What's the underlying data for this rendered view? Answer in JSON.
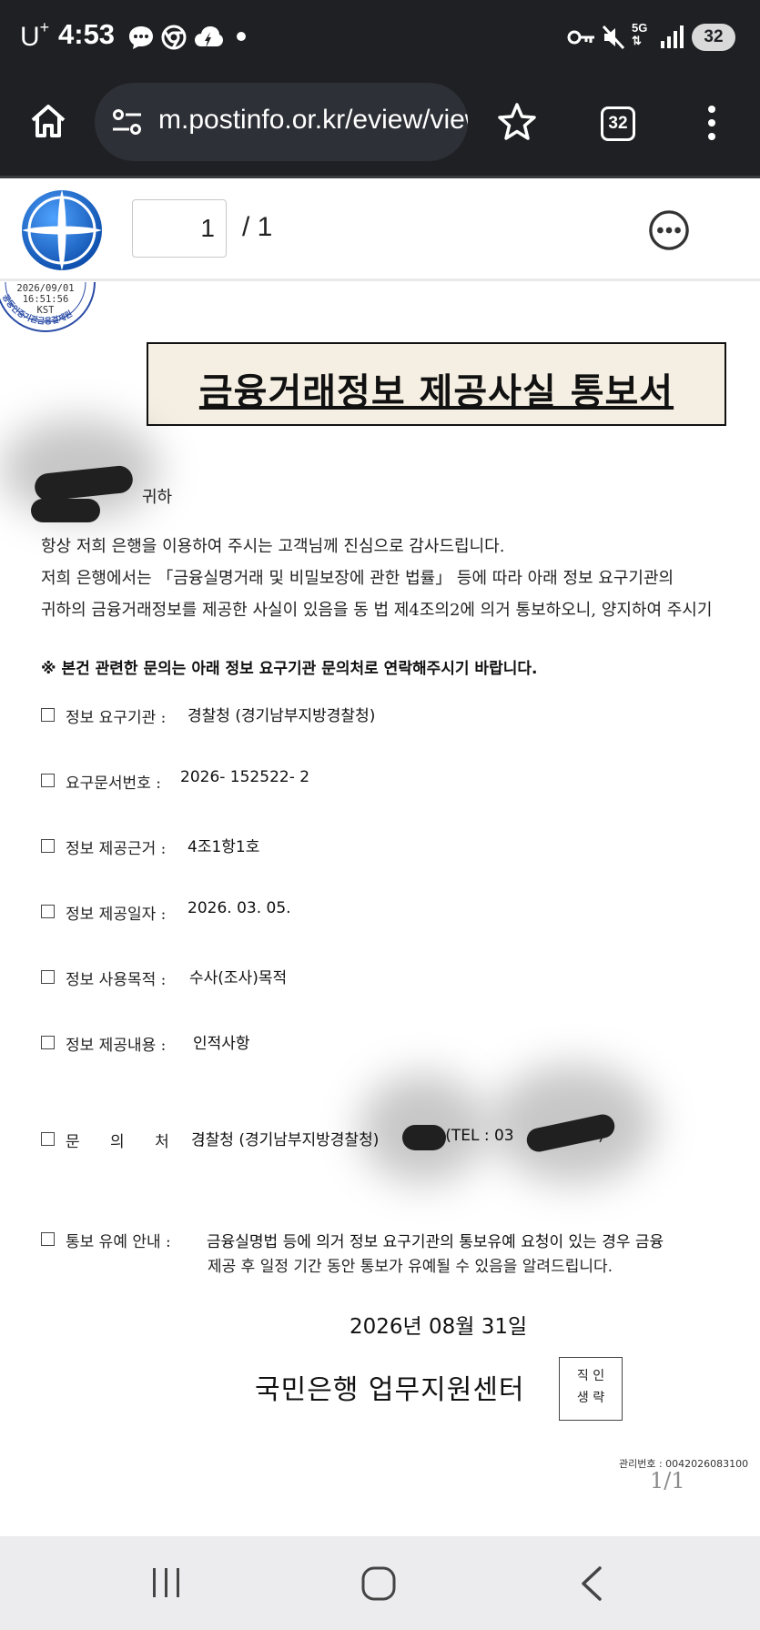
{
  "status_bar": {
    "carrier": "U",
    "carrier_sup": "+",
    "time": "4:53",
    "battery": "32",
    "network": "5G"
  },
  "browser": {
    "url": "m.postinfo.or.kr/eview/view",
    "tab_count": "32"
  },
  "viewer": {
    "page_current": "1",
    "page_total": "/ 1"
  },
  "document": {
    "stamp_date": "2026/09/01",
    "stamp_time": "16:51:56",
    "stamp_zone": "KST",
    "stamp_ring_text": "공동인증기관금융결제원",
    "title": "금융거래정보 제공사실 통보서",
    "addressee_suffix": "귀하",
    "intro_line1": "항상 저희 은행을 이용하여 주시는 고객님께 진심으로 감사드립니다.",
    "intro_line2": "저희 은행에서는 「금융실명거래 및 비밀보장에 관한 법률」 등에 따라 아래 정보 요구기관의",
    "intro_line3": "귀하의 금융거래정보를 제공한 사실이 있음을 동 법 제4조의2에 의거 통보하오니, 양지하여 주시기",
    "notice": "※ 본건 관련한 문의는 아래 정보 요구기관 문의처로 연락해주시기 바랍니다.",
    "fields": [
      {
        "label": "정보 요구기관 :",
        "value": "경찰청 (경기남부지방경찰청)"
      },
      {
        "label": "요구문서번호 :",
        "value": "2026- 152522- 2"
      },
      {
        "label": "정보 제공근거 :",
        "value": "4조1항1호"
      },
      {
        "label": "정보 제공일자 :",
        "value": "2026. 03. 05."
      },
      {
        "label": "정보 사용목적 :",
        "value": "수사(조사)목적"
      },
      {
        "label": "정보 제공내용 :",
        "value": "인적사항"
      },
      {
        "label": "문 의 처 :",
        "value": "경찰청 (경기남부지방경찰청)",
        "value_tail": "! (TEL : 03",
        "value_end": ")"
      },
      {
        "label": "통보 유예 안내 :",
        "value": "금융실명법 등에 의거 정보 요구기관의 통보유예 요청이 있는 경우 금융",
        "value_cont": "제공 후 일정 기간 동안 통보가 유예될 수 있음을 알려드립니다."
      }
    ],
    "date": "2026년 08월 31일",
    "issuer": "국민은행 업무지원센터",
    "seal_line1": "직 인",
    "seal_line2": "생 략",
    "mgmt_label": "관리번호",
    "mgmt_number": ": 0042026083100",
    "page_indicator": "1/1"
  },
  "colors": {
    "dark_bar": "#1f2023",
    "title_box_bg": "#f4efe2",
    "nav_bar": "#ececee",
    "logo_blue": "#1e63c4"
  },
  "icons": [
    "chat-bubble-icon",
    "chrome-icon",
    "cloud-icon",
    "key-icon",
    "mute-icon",
    "signal-icon",
    "home-icon",
    "site-info-icon",
    "star-icon",
    "tabs-icon",
    "menu-icon",
    "logo-icon",
    "more-icon",
    "recent-apps-icon",
    "home-nav-icon",
    "back-icon"
  ]
}
